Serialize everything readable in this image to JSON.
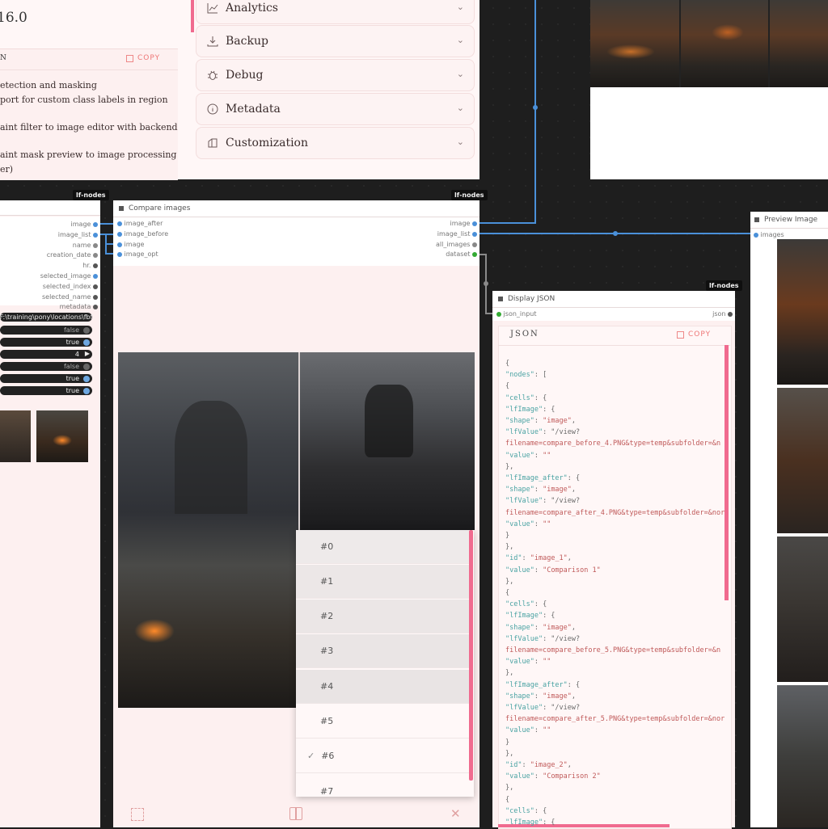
{
  "top_panel": {
    "version": "16.0",
    "changelog_label": "N",
    "copy_label": "COPY",
    "changelog_lines": [
      "etection and masking",
      "port for custom class labels in region",
      "aint filter to image editor with backend",
      "aint mask preview to image processing",
      "er)"
    ],
    "accordions": [
      {
        "label": "Analytics",
        "icon": "chart-icon"
      },
      {
        "label": "Backup",
        "icon": "download-icon"
      },
      {
        "label": "Debug",
        "icon": "bug-icon"
      },
      {
        "label": "Metadata",
        "icon": "info-icon"
      },
      {
        "label": "Customization",
        "icon": "palette-icon"
      }
    ]
  },
  "left_node": {
    "tag": "lf-nodes",
    "outputs": [
      "image",
      "image_list",
      "name",
      "creation_date",
      "hr.",
      "selected_image",
      "selected_index",
      "selected_name",
      "metadata"
    ],
    "path_value": "F:\\training\\pony\\locations\\fbf",
    "toggles": [
      "false",
      "true",
      "4",
      "false",
      "true",
      "true"
    ]
  },
  "compare_node": {
    "tag": "lf-nodes",
    "title": "Compare images",
    "inputs": [
      "image_after",
      "image_before",
      "image",
      "image_opt"
    ],
    "outputs": [
      "image",
      "image_list",
      "all_images",
      "dataset"
    ],
    "options": [
      "#0",
      "#1",
      "#2",
      "#3",
      "#4",
      "#5",
      "#6",
      "#7"
    ],
    "selected_option": "#6"
  },
  "json_node": {
    "tag": "lf-nodes",
    "title": "Display JSON",
    "input": "json_input",
    "output": "json",
    "header": "JSON",
    "copy_label": "COPY",
    "lines": [
      "{",
      "  \"nodes\": [",
      "    {",
      "      \"cells\": {",
      "        \"lfImage\": {",
      "          \"shape\": \"image\",",
      "          \"lfValue\": \"/view?",
      "filename=compare_before_4.PNG&type=temp&subfolder=&n",
      "          \"value\": \"\"",
      "        },",
      "        \"lfImage_after\": {",
      "          \"shape\": \"image\",",
      "          \"lfValue\": \"/view?",
      "filename=compare_after_4.PNG&type=temp&subfolder=&nor",
      "          \"value\": \"\"",
      "        }",
      "      },",
      "      \"id\": \"image_1\",",
      "      \"value\": \"Comparison 1\"",
      "    },",
      "    {",
      "      \"cells\": {",
      "        \"lfImage\": {",
      "          \"shape\": \"image\",",
      "          \"lfValue\": \"/view?",
      "filename=compare_before_5.PNG&type=temp&subfolder=&n",
      "          \"value\": \"\"",
      "        },",
      "        \"lfImage_after\": {",
      "          \"shape\": \"image\",",
      "          \"lfValue\": \"/view?",
      "filename=compare_after_5.PNG&type=temp&subfolder=&nor",
      "          \"value\": \"\"",
      "        }",
      "      },",
      "      \"id\": \"image_2\",",
      "      \"value\": \"Comparison 2\"",
      "    },",
      "    {",
      "      \"cells\": {",
      "        \"lfImage\": {"
    ]
  },
  "preview_node": {
    "title": "Preview Image",
    "input": "images"
  },
  "colors": {
    "accent": "#f06b8f",
    "wire": "#4a90d9",
    "node_bg": "#fdf0f0"
  }
}
